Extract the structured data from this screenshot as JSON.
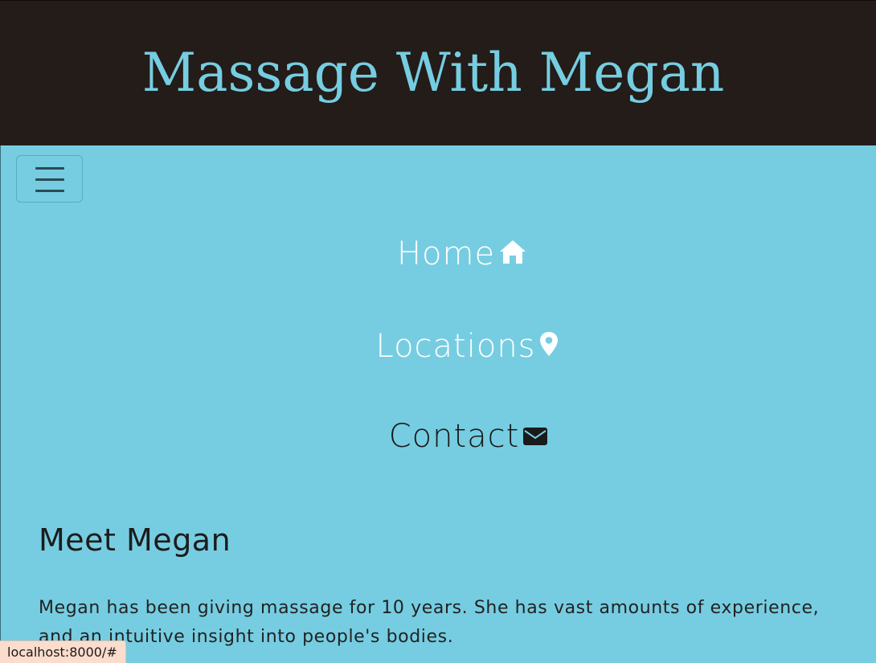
{
  "site": {
    "title": "Massage With Megan"
  },
  "nav": {
    "toggler_label": "Toggle navigation",
    "items": [
      {
        "label": "Home",
        "icon": "home-icon"
      },
      {
        "label": "Locations",
        "icon": "map-marker-icon"
      },
      {
        "label": "Contact",
        "icon": "envelope-icon"
      }
    ]
  },
  "about": {
    "heading": "Meet Megan",
    "text": "Megan has been giving massage for 10 years. She has vast amounts of experience, and an intuitive insight into people's bodies."
  },
  "status": {
    "url": "localhost:8000/#"
  },
  "colors": {
    "header_bg": "#231c18",
    "accent": "#76cde1",
    "active_nav": "#ffffff",
    "text_dark": "#1c1c1c"
  }
}
